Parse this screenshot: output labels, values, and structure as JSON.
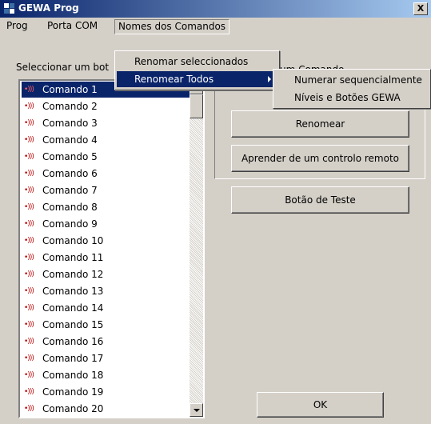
{
  "window": {
    "title": "GEWA Prog",
    "close_label": "X"
  },
  "menubar": {
    "items": [
      "Prog",
      "Porta COM",
      "Nomes dos Comandos"
    ]
  },
  "dropdown": {
    "items": [
      "Renomar seleccionados",
      "Renomear Todos"
    ]
  },
  "submenu": {
    "items": [
      "Numerar sequencialmente",
      "Níveis e Botões GEWA"
    ]
  },
  "list": {
    "label": "Seleccionar um bot",
    "selected_index": 0,
    "items": [
      "Comando 1",
      "Comando 2",
      "Comando 3",
      "Comando 4",
      "Comando 5",
      "Comando 6",
      "Comando 7",
      "Comando 8",
      "Comando 9",
      "Comando 10",
      "Comando 11",
      "Comando 12",
      "Comando 13",
      "Comando 14",
      "Comando 15",
      "Comando 16",
      "Comando 17",
      "Comando 18",
      "Comando 19",
      "Comando 20"
    ],
    "item_icon": "•)))"
  },
  "group": {
    "label": "um Comando"
  },
  "buttons": {
    "rename": "Renomear",
    "learn": "Aprender de um controlo remoto",
    "test": "Botão de Teste",
    "ok": "OK"
  }
}
